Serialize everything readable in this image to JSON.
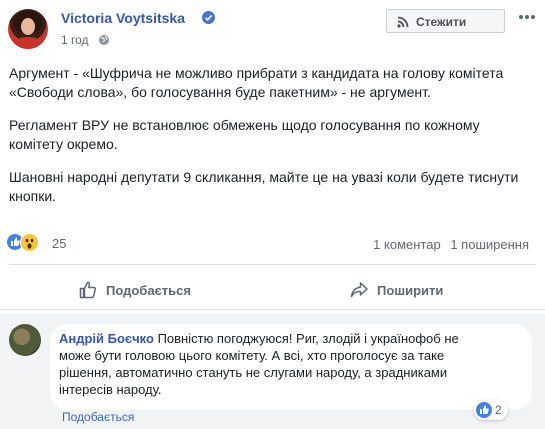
{
  "post": {
    "author": "Victoria Voytsitska",
    "time": "1 год",
    "follow_label": "Стежити",
    "paragraphs": [
      "Аргумент - «Шуфрича не можливо прибрати з кандидата на голову комітета «Свободи слова», бо голосування буде пакетним» - не аргумент.",
      "Регламент ВРУ не встановлює обмежень щодо голосування по кожному комітету окремо.",
      "Шановні народні депутати 9 скликання, майте це на увазі коли будете тиснути кнопки."
    ],
    "reaction_count": "25",
    "comments_count": "1 коментар",
    "shares_count": "1 поширення"
  },
  "actions": {
    "like_label": "Подобається",
    "share_label": "Поширити"
  },
  "comment": {
    "author": "Андрій Боєчко",
    "text": "Повністю погоджуюся! Риг, злодій і українофоб не може бути головою цього комітету. А всі, хто проголосує за таке рішення, автоматично стануть не слугами народу, а зрадниками інтересів народу.",
    "like_label": "Подобається",
    "like_count": "2"
  },
  "colors": {
    "link": "#385898",
    "accent": "#4267b2",
    "secondary_text": "#616770"
  },
  "icons": [
    "verified-icon",
    "globe-icon",
    "rss-icon",
    "more-icon",
    "like-reaction-icon",
    "wow-reaction-icon",
    "thumbs-up-icon",
    "share-arrow-icon"
  ]
}
